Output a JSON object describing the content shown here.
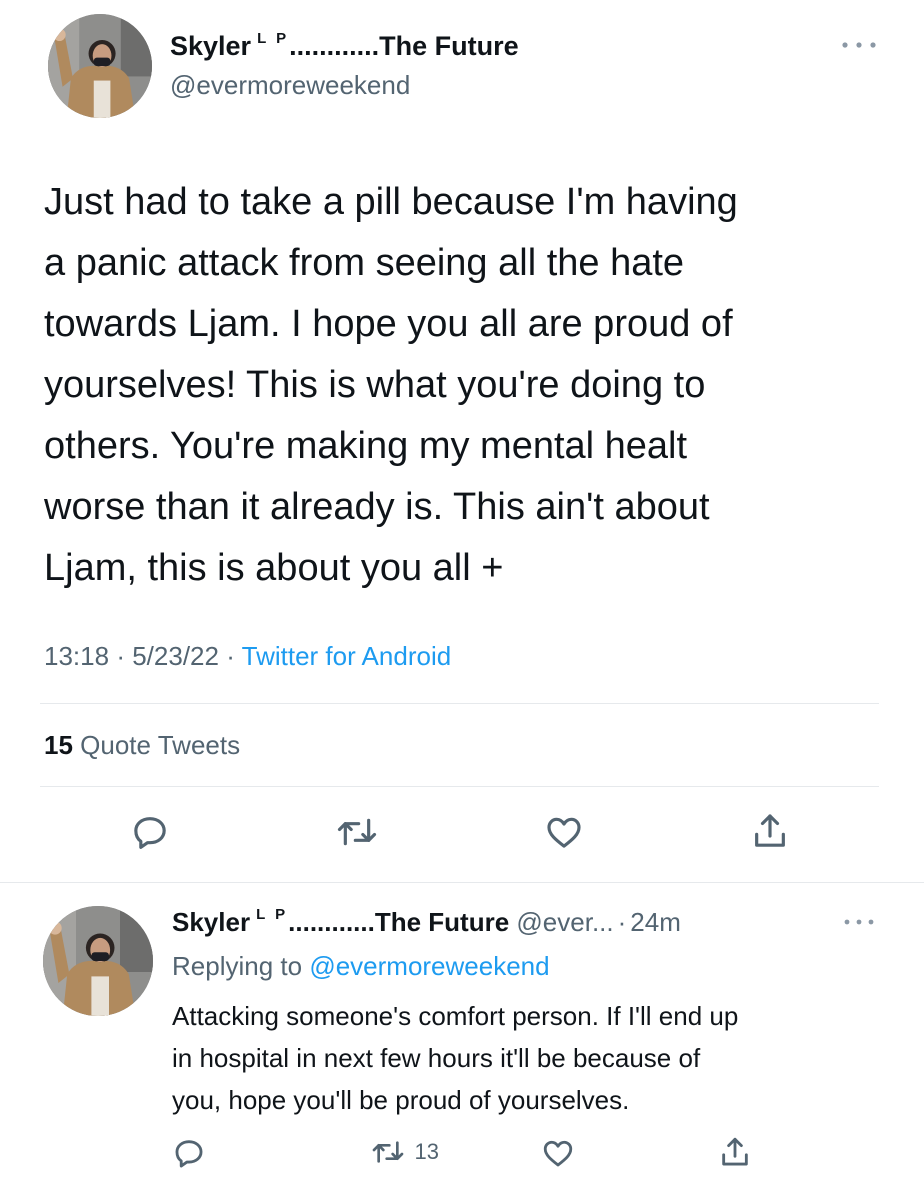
{
  "main_tweet": {
    "display_name": "Skyler",
    "name_superscript": "L P",
    "name_suffix": "............The Future",
    "handle": "@evermoreweekend",
    "body_lines": [
      "Just had to take a pill because I'm having",
      "a panic attack from seeing all the hate",
      "towards Ljam. I hope you all are proud of",
      "yourselves! This is what you're doing to",
      "others. You're making my mental healt",
      "worse than it already is. This ain't about",
      "Ljam, this is about you all +"
    ],
    "time": "13:18",
    "sep1": "·",
    "date": "5/23/22",
    "sep2": "·",
    "source": "Twitter for Android",
    "quote_count": "15",
    "quote_label": "Quote Tweets"
  },
  "reply_tweet": {
    "display_name": "Skyler",
    "name_superscript": "L P",
    "name_suffix": "............The Future",
    "handle_truncated": "@ever...",
    "sep": "·",
    "age": "24m",
    "replying_prefix": "Replying to",
    "replying_handle": "@evermoreweekend",
    "body_lines": [
      "Attacking someone's comfort person. If I'll end up",
      "in hospital in next few hours it'll be because of",
      "you, hope you'll be proud of yourselves."
    ],
    "retweet_count": "13"
  },
  "icons": {
    "more": "more-horizontal-icon",
    "reply": "reply-icon",
    "retweet": "retweet-icon",
    "like": "heart-icon",
    "share": "share-icon"
  },
  "colors": {
    "text": "#0f1419",
    "muted": "#536471",
    "link": "#1d9bf0",
    "divider": "#e6e9ec"
  }
}
